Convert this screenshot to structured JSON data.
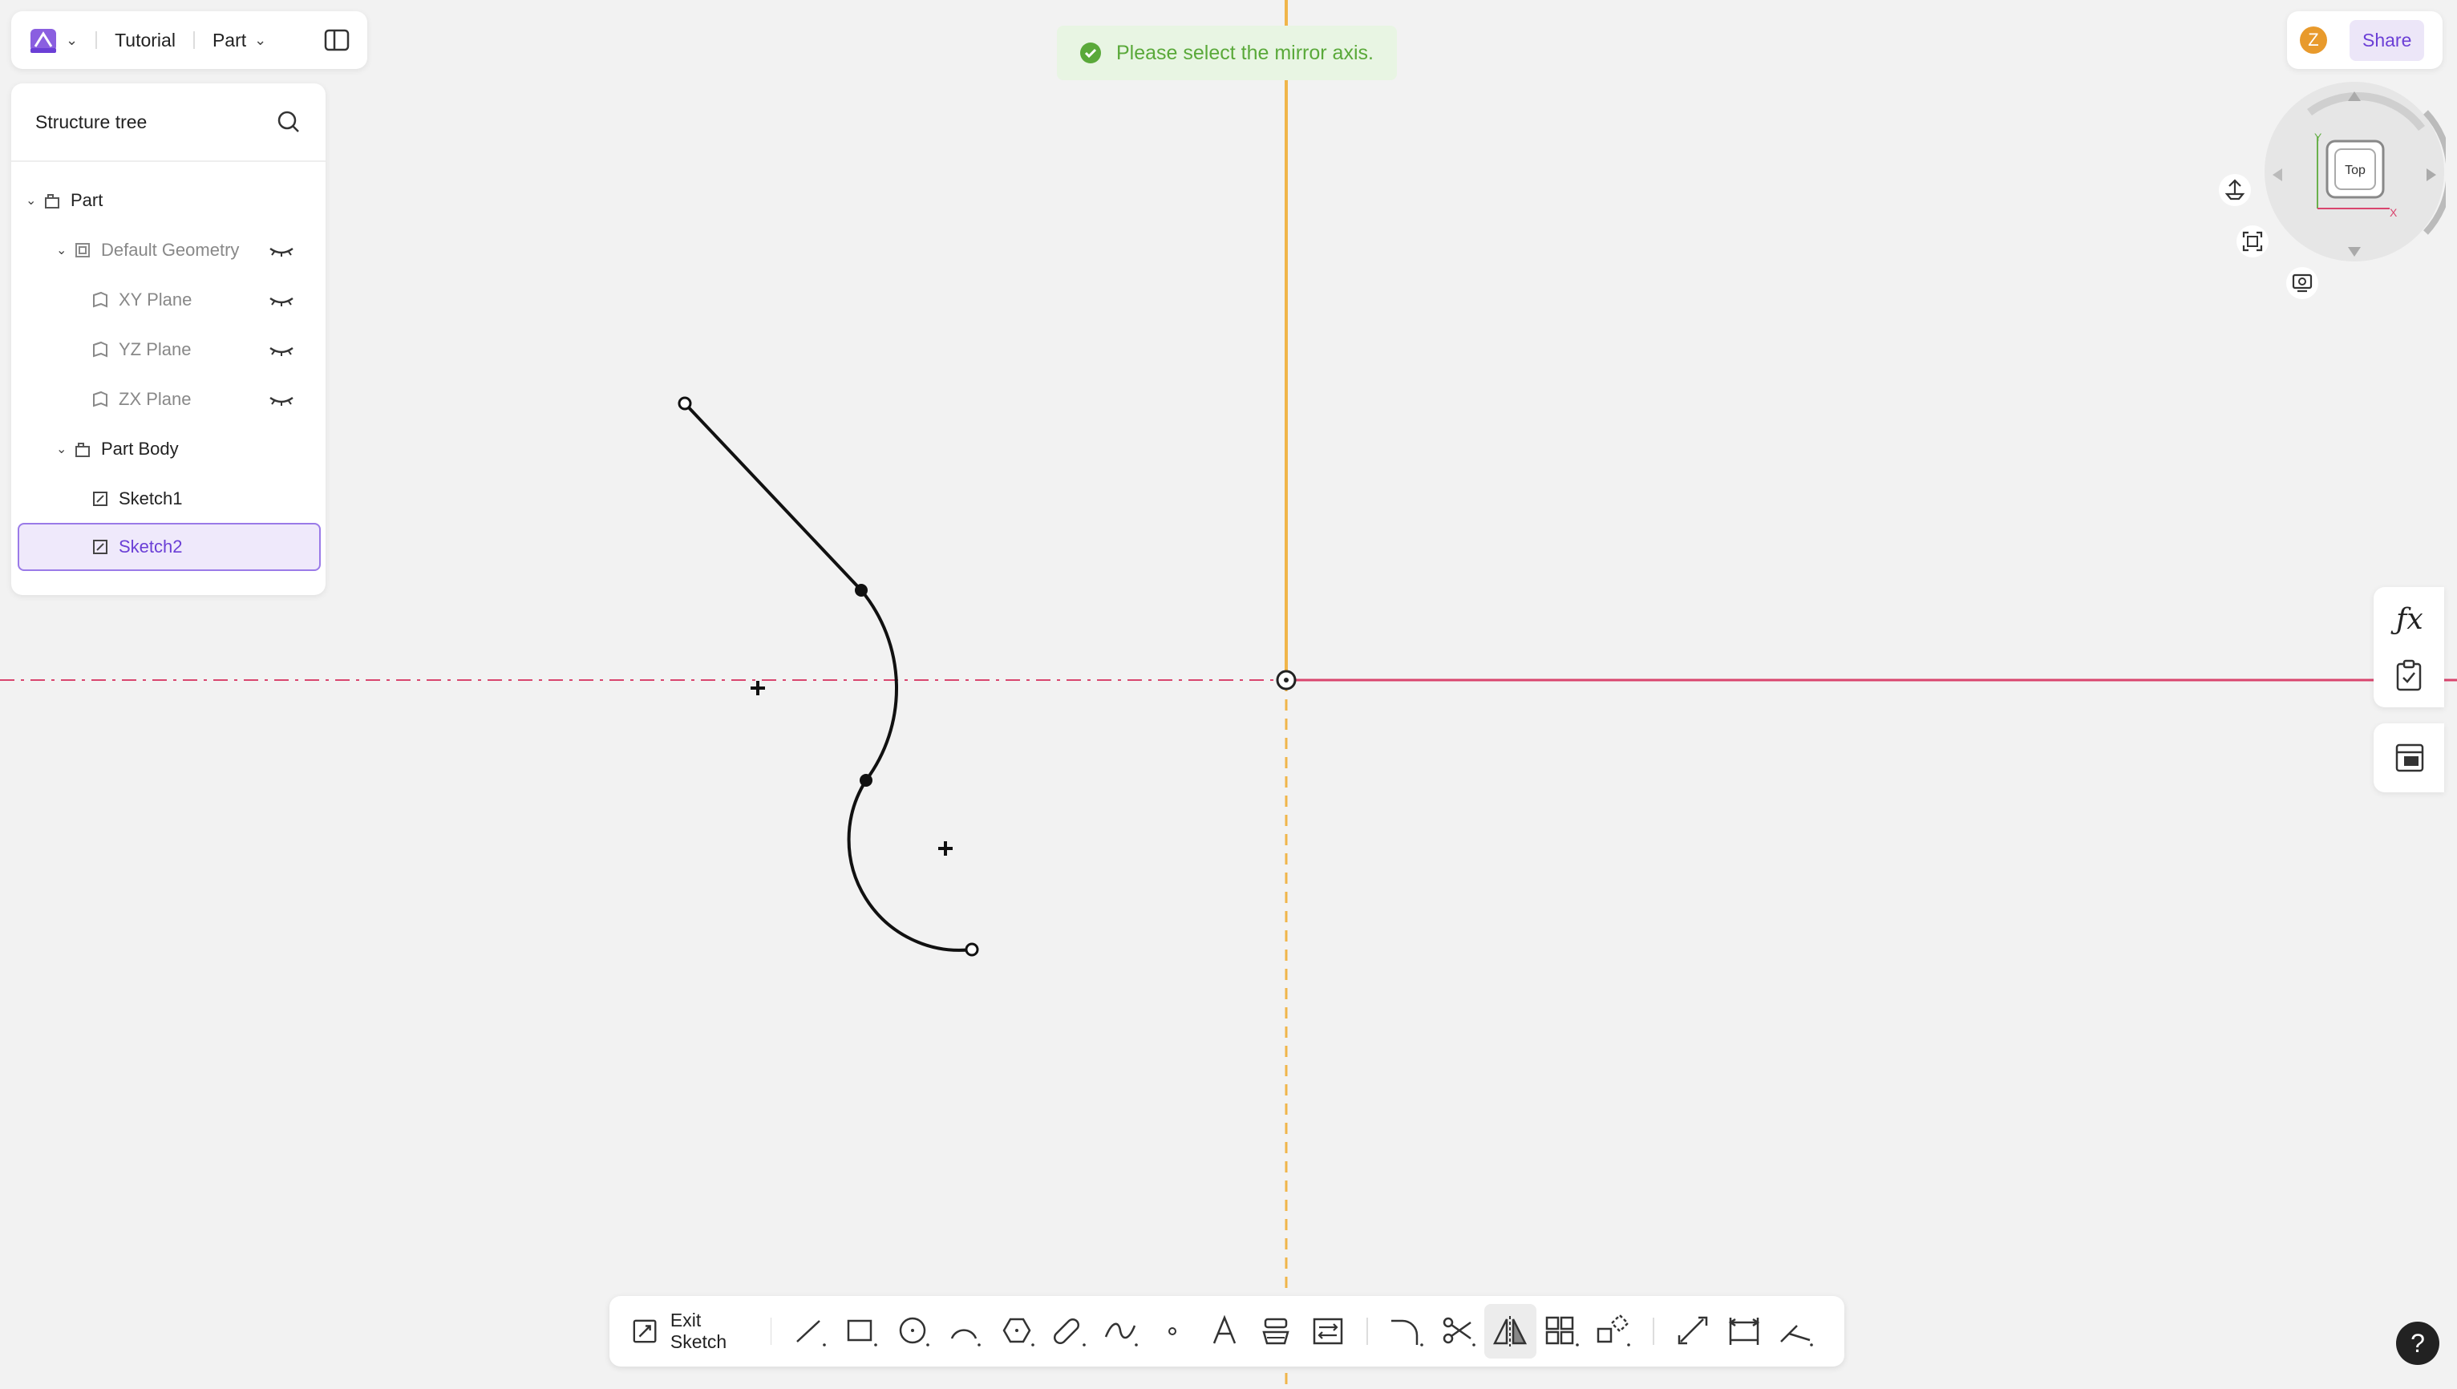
{
  "header": {
    "project_name": "Tutorial",
    "mode_label": "Part"
  },
  "tree": {
    "title": "Structure tree",
    "nodes": [
      {
        "label": "Part"
      },
      {
        "label": "Default Geometry"
      },
      {
        "label": "XY Plane"
      },
      {
        "label": "YZ Plane"
      },
      {
        "label": "ZX Plane"
      },
      {
        "label": "Part Body"
      },
      {
        "label": "Sketch1"
      },
      {
        "label": "Sketch2"
      }
    ]
  },
  "toast": {
    "message": "Please select the mirror axis."
  },
  "user": {
    "avatar_initial": "Z",
    "share_label": "Share"
  },
  "viewcube": {
    "face_label": "Top",
    "axis_x": "X",
    "axis_y": "Y"
  },
  "toolbar": {
    "exit_label": "Exit Sketch",
    "active_tool": "mirror"
  },
  "colors": {
    "accent": "#6b3fd6",
    "vertical_axis": "#f0b54a",
    "horizontal_axis": "#d9456e",
    "toast_green": "#5aa93a"
  },
  "help_label": "?"
}
